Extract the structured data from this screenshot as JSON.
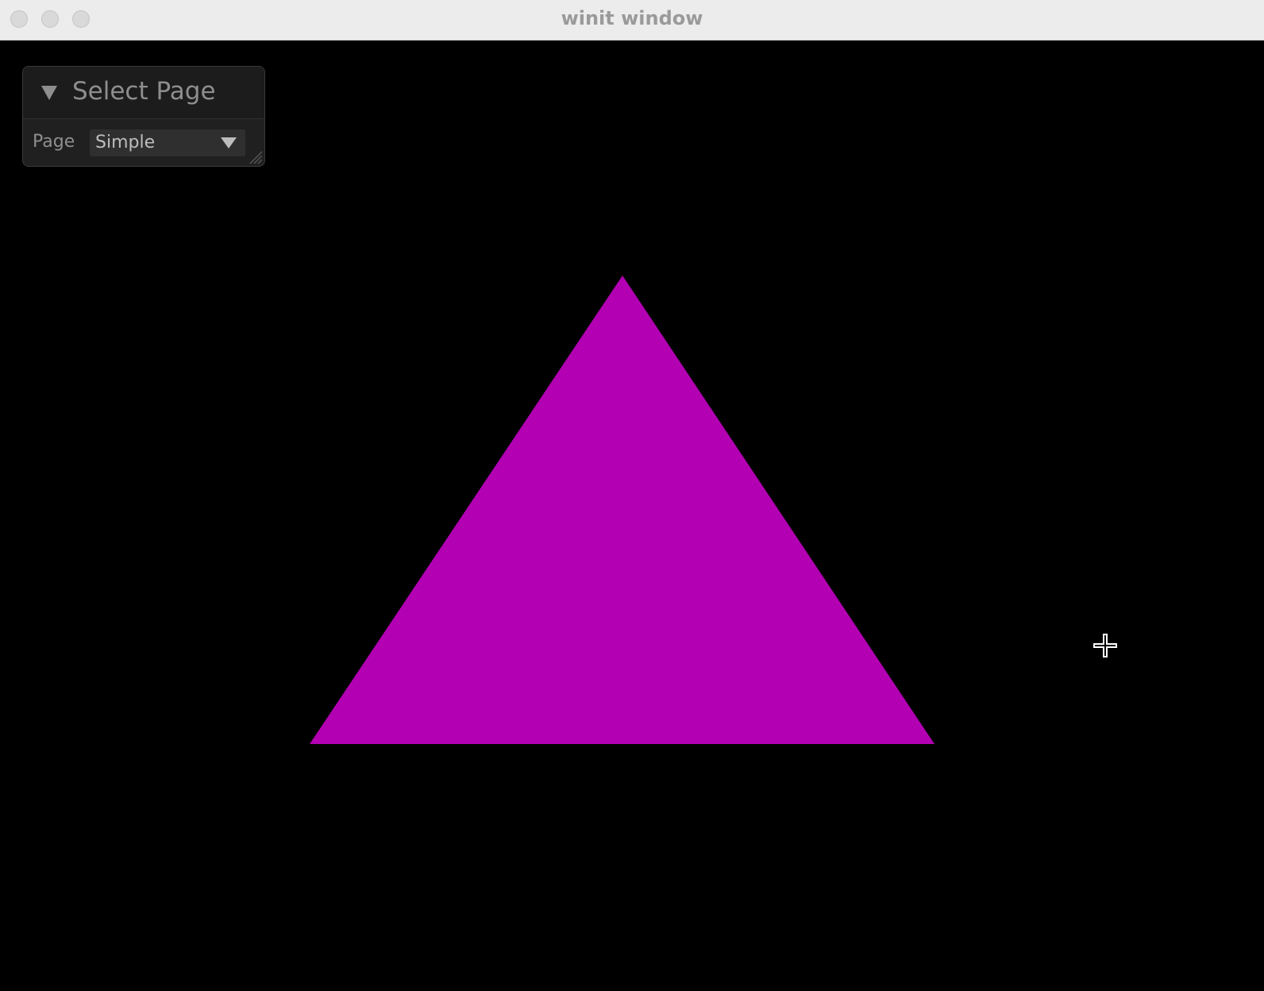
{
  "window": {
    "title": "winit window"
  },
  "panel": {
    "title": "Select Page",
    "collapse_icon": "triangle-down-icon",
    "row_label": "Page",
    "select_value": "Simple",
    "select_icon": "chevron-down-icon"
  },
  "scene": {
    "shape": "triangle",
    "fill_color": "#b200b2",
    "background_color": "#000000"
  },
  "cursor": {
    "icon": "crosshair-cursor-icon"
  }
}
